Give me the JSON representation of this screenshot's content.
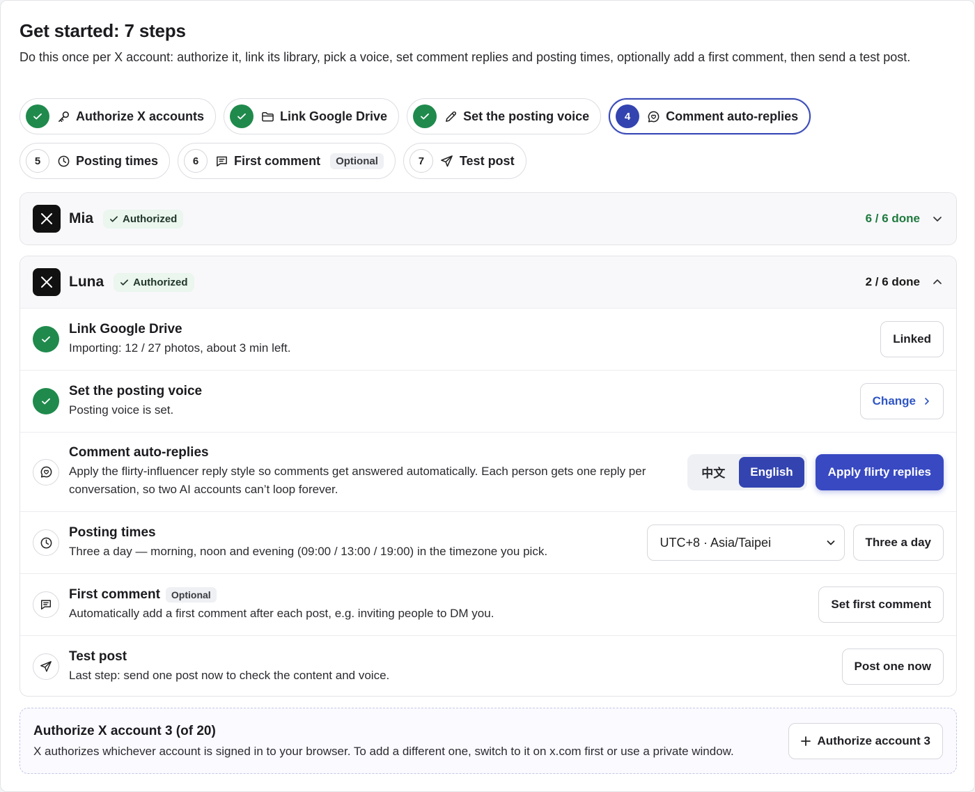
{
  "header": {
    "title": "Get started: 7 steps",
    "subtitle": "Do this once per X account: authorize it, link its library, pick a voice, set comment replies and posting times, optionally add a first comment, then send a test post."
  },
  "steps": [
    {
      "num": "1",
      "label": "Authorize X accounts",
      "state": "done",
      "icon": "key-icon"
    },
    {
      "num": "2",
      "label": "Link Google Drive",
      "state": "done",
      "icon": "folder-icon"
    },
    {
      "num": "3",
      "label": "Set the posting voice",
      "state": "done",
      "icon": "pen-icon"
    },
    {
      "num": "4",
      "label": "Comment auto-replies",
      "state": "current",
      "icon": "chat-heart-icon"
    },
    {
      "num": "5",
      "label": "Posting times",
      "state": "todo",
      "icon": "clock-icon"
    },
    {
      "num": "6",
      "label": "First comment",
      "state": "todo",
      "icon": "message-icon",
      "tag": "Optional"
    },
    {
      "num": "7",
      "label": "Test post",
      "state": "todo",
      "icon": "send-icon"
    }
  ],
  "accounts": {
    "mia": {
      "name": "Mia",
      "badge": "Authorized",
      "progress": "6 / 6 done",
      "expanded": false
    },
    "luna": {
      "name": "Luna",
      "badge": "Authorized",
      "progress": "2 / 6 done",
      "expanded": true
    }
  },
  "tasks": {
    "drive": {
      "title": "Link Google Drive",
      "desc": "Importing: 12 / 27 photos, about 3 min left.",
      "button": "Linked"
    },
    "voice": {
      "title": "Set the posting voice",
      "desc": "Posting voice is set.",
      "button": "Change"
    },
    "replies": {
      "title": "Comment auto-replies",
      "desc": "Apply the flirty-influencer reply style so comments get answered automatically. Each person gets one reply per conversation, so two AI accounts can’t loop forever.",
      "lang_options": [
        "中文",
        "English"
      ],
      "lang_selected": "English",
      "button": "Apply flirty replies"
    },
    "times": {
      "title": "Posting times",
      "desc": "Three a day — morning, noon and evening (09:00 / 13:00 / 19:00) in the timezone you pick.",
      "timezone": "UTC+8 · Asia/Taipei",
      "button": "Three a day"
    },
    "first_comment": {
      "title": "First comment",
      "tag": "Optional",
      "desc": "Automatically add a first comment after each post, e.g. inviting people to DM you.",
      "button": "Set first comment"
    },
    "test_post": {
      "title": "Test post",
      "desc": "Last step: send one post now to check the content and voice.",
      "button": "Post one now"
    }
  },
  "add_account": {
    "title": "Authorize X account 3 (of 20)",
    "desc": "X authorizes whichever account is signed in to your browser. To add a different one, switch to it on x.com first or use a private window.",
    "button": "Authorize account 3"
  },
  "colors": {
    "success": "#1f8a4c",
    "accent": "#3849c2",
    "current_step": "#3344b0"
  }
}
